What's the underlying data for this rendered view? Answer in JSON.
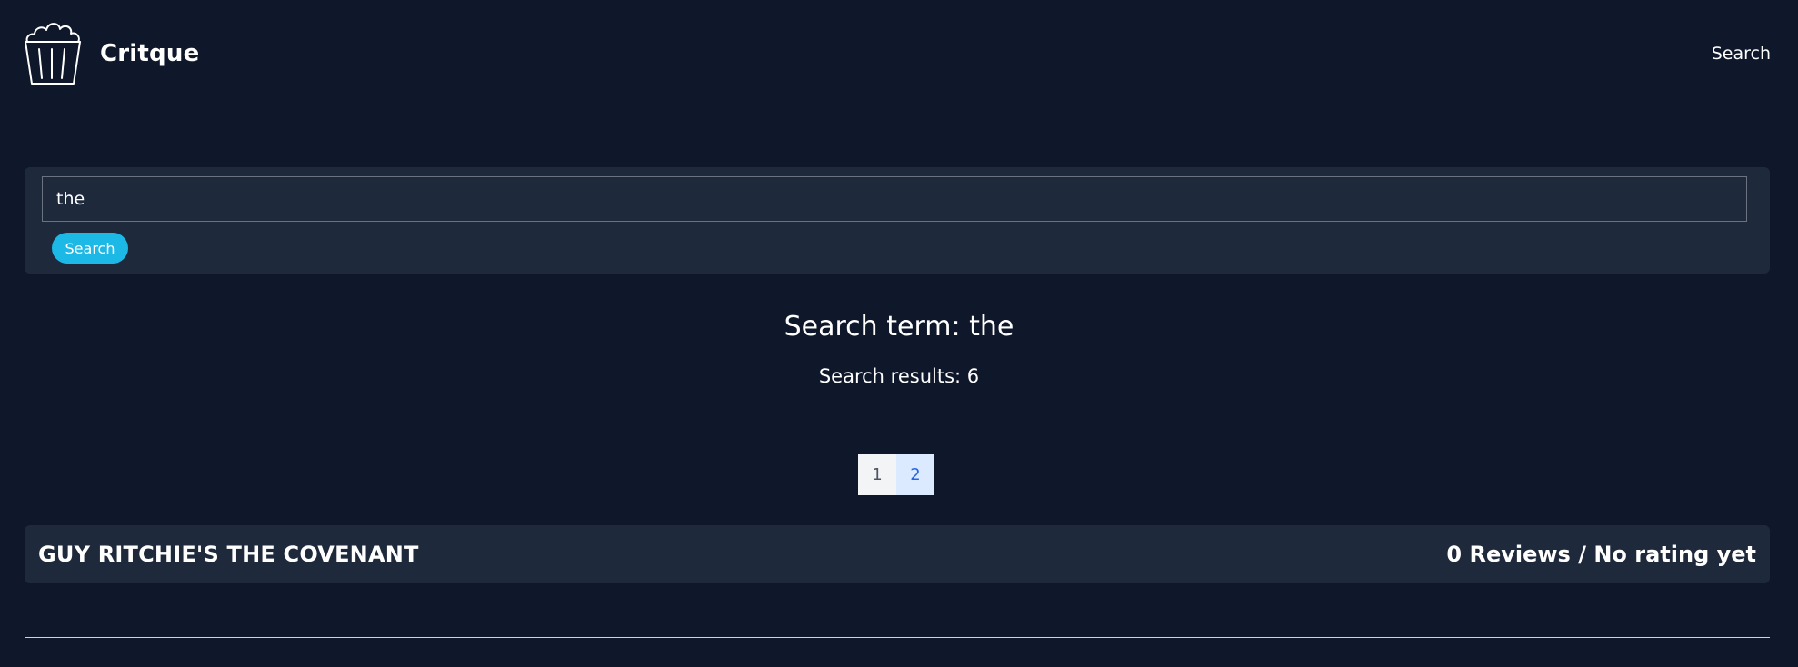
{
  "header": {
    "brand": "Critque",
    "nav_search_label": "Search",
    "logo_icon": "popcorn-bucket-icon"
  },
  "search": {
    "value": "the",
    "button_label": "Search",
    "accent_color": "#1cb8e6"
  },
  "results": {
    "term_heading": "Search term: the",
    "count_text": "Search results: 6"
  },
  "pagination": {
    "pages": [
      "1",
      "2"
    ],
    "active_page": "2"
  },
  "movies": [
    {
      "title": "GUY RITCHIE'S THE COVENANT",
      "summary": "0 Reviews / No rating yet"
    }
  ],
  "colors": {
    "background": "#0f172a",
    "panel": "#1e293b"
  }
}
